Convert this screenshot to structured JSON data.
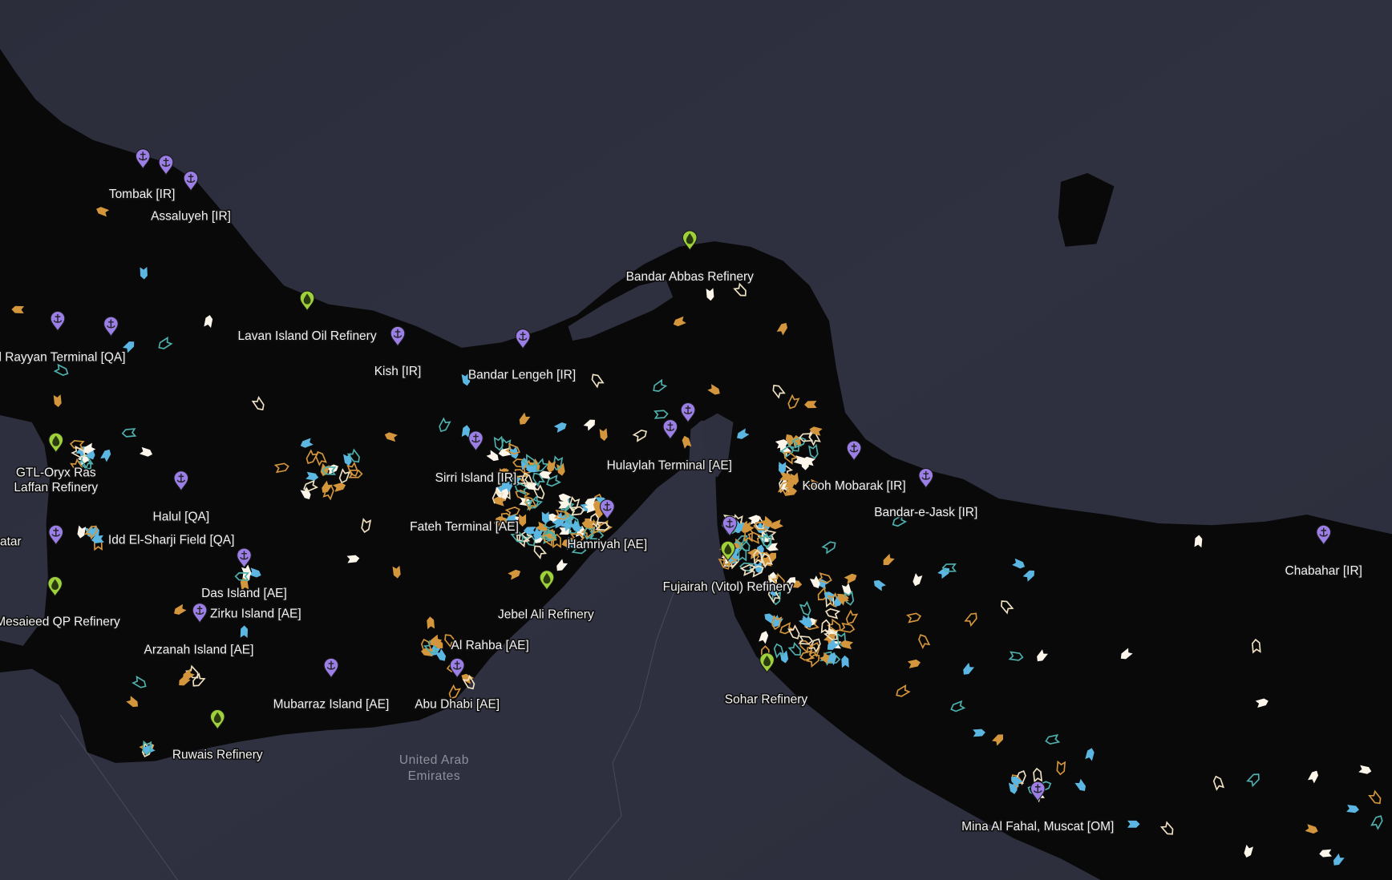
{
  "map": {
    "colors": {
      "land": "#2e303f",
      "water": "#090909",
      "port_pin": "#9b7fe6",
      "refinery_pin": "#9fd13a",
      "vessel_blue": "#5bb6e2",
      "vessel_white": "#fbf5ea",
      "vessel_orange": "#d4963c",
      "vessel_teal": "#4fb0ad",
      "vessel_cream": "#efe1c2"
    },
    "country_label": [
      "United Arab",
      "Emirates"
    ],
    "labels": [
      "Tombak [IR]",
      "Assaluyeh [IR]",
      "Lavan Island Oil Refinery",
      "l Rayyan Terminal [QA]",
      "Kish [IR]",
      "Bandar Lengeh [IR]",
      "Bandar Abbas Refinery",
      "Hulaylah Terminal [AE]",
      "Sirri Island [IR]",
      "GTL-Oryx Ras",
      "Laffan Refinery",
      "Kooh Mobarak [IR]",
      "Bandar-e-Jask [IR]",
      "Halul [QA]",
      "Idd El-Sharji Field [QA]",
      "atar",
      "Fateh Terminal [AE]",
      "Hamriyah [AE]",
      "Chabahar [IR]",
      "Fujairah (Vitol) Refinery",
      "Das Island [AE]",
      "Zirku Island [AE]",
      "Jebel Ali Refinery",
      "Mesaieed QP Refinery",
      "Al Rahba [AE]",
      "Arzanah Island [AE]",
      "Sohar Refinery",
      "Mubarraz Island [AE]",
      "Abu Dhabi [AE]",
      "Ruwais Refinery",
      "Mina Al Fahal, Muscat [OM]"
    ],
    "pin_icons": {
      "port": "anchor-icon",
      "refinery": "oil-drop-icon"
    }
  }
}
